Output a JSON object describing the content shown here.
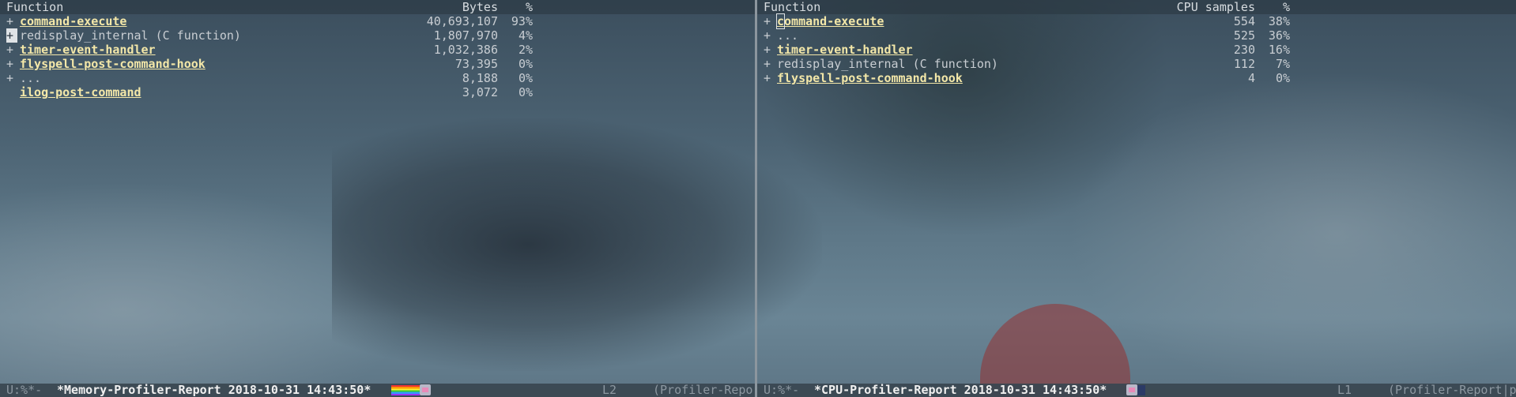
{
  "memory_report": {
    "headers": {
      "function": "Function",
      "bytes": "Bytes",
      "percent": "%"
    },
    "rows": [
      {
        "expander": "+",
        "name": "command-execute",
        "is_link": true,
        "bytes": "40,693,107",
        "percent": "93%"
      },
      {
        "expander": "+",
        "name": "redisplay_internal (C function)",
        "is_link": false,
        "bytes": "1,807,970",
        "percent": "4%",
        "cursor": true
      },
      {
        "expander": "+",
        "name": "timer-event-handler",
        "is_link": true,
        "bytes": "1,032,386",
        "percent": "2%"
      },
      {
        "expander": "+",
        "name": "flyspell-post-command-hook",
        "is_link": true,
        "bytes": "73,395",
        "percent": "0%"
      },
      {
        "expander": "+",
        "name": "...",
        "is_link": false,
        "bytes": "8,188",
        "percent": "0%"
      },
      {
        "expander": "",
        "name": "ilog-post-command",
        "is_link": true,
        "bytes": "3,072",
        "percent": "0%"
      }
    ],
    "modeline": {
      "status": "U:%*-",
      "buffer": "*Memory-Profiler-Report 2018-10-31 14:43:50*",
      "line": "L2",
      "mode": "(Profiler-Repor"
    }
  },
  "cpu_report": {
    "headers": {
      "function": "Function",
      "samples": "CPU samples",
      "percent": "%"
    },
    "rows": [
      {
        "expander": "+",
        "name": "command-execute",
        "is_link": true,
        "samples": "554",
        "percent": "38%",
        "cursor_first_char": true
      },
      {
        "expander": "+",
        "name": "...",
        "is_link": false,
        "samples": "525",
        "percent": "36%"
      },
      {
        "expander": "+",
        "name": "timer-event-handler",
        "is_link": true,
        "samples": "230",
        "percent": "16%"
      },
      {
        "expander": "+",
        "name": "redisplay_internal (C function)",
        "is_link": false,
        "samples": "112",
        "percent": "7%"
      },
      {
        "expander": "+",
        "name": "flyspell-post-command-hook",
        "is_link": true,
        "samples": "4",
        "percent": "0%"
      }
    ],
    "modeline": {
      "status": "U:%*-",
      "buffer": "*CPU-Profiler-Report 2018-10-31 14:43:50*",
      "line": "L1",
      "mode": "(Profiler-Report|p"
    }
  },
  "colors": {
    "link": "#f3e7a8",
    "text": "#c8cdd2",
    "modeline_bg": "#3a4650",
    "divider": "#8c969e"
  },
  "icons": {
    "nyan": "nyan-cat-progress-icon"
  }
}
